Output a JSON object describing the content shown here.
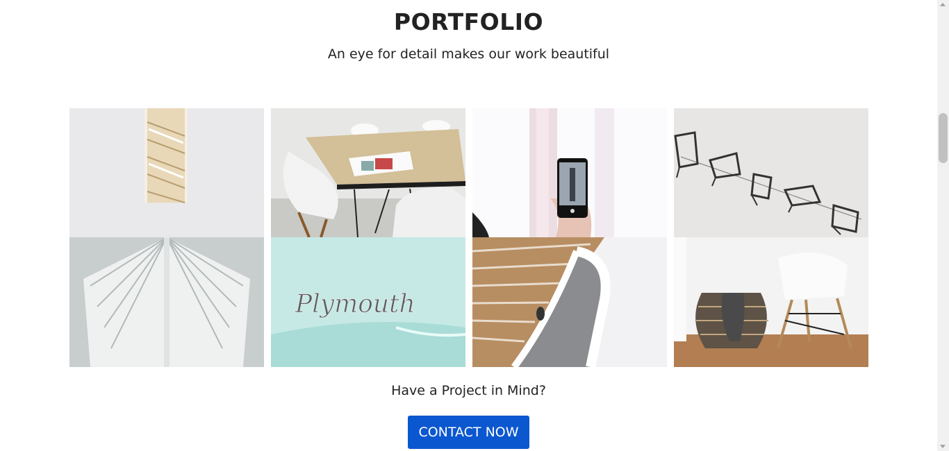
{
  "portfolio": {
    "title": "PORTFOLIO",
    "subtitle": "An eye for detail makes our work beautiful",
    "items": [
      {
        "icon": "staircase-window-photo"
      },
      {
        "icon": "table-chairs-photo"
      },
      {
        "icon": "phone-camera-photo"
      },
      {
        "icon": "flying-chairs-photo"
      },
      {
        "icon": "architecture-ribs-photo"
      },
      {
        "icon": "plymouth-car-photo"
      },
      {
        "icon": "spiral-stairs-photo"
      },
      {
        "icon": "basket-chair-photo"
      }
    ],
    "car_badge_text": "Plymouth"
  },
  "cta": {
    "heading": "Have a Project in Mind?",
    "button_label": "CONTACT NOW",
    "button_color": "#0b57d0"
  }
}
